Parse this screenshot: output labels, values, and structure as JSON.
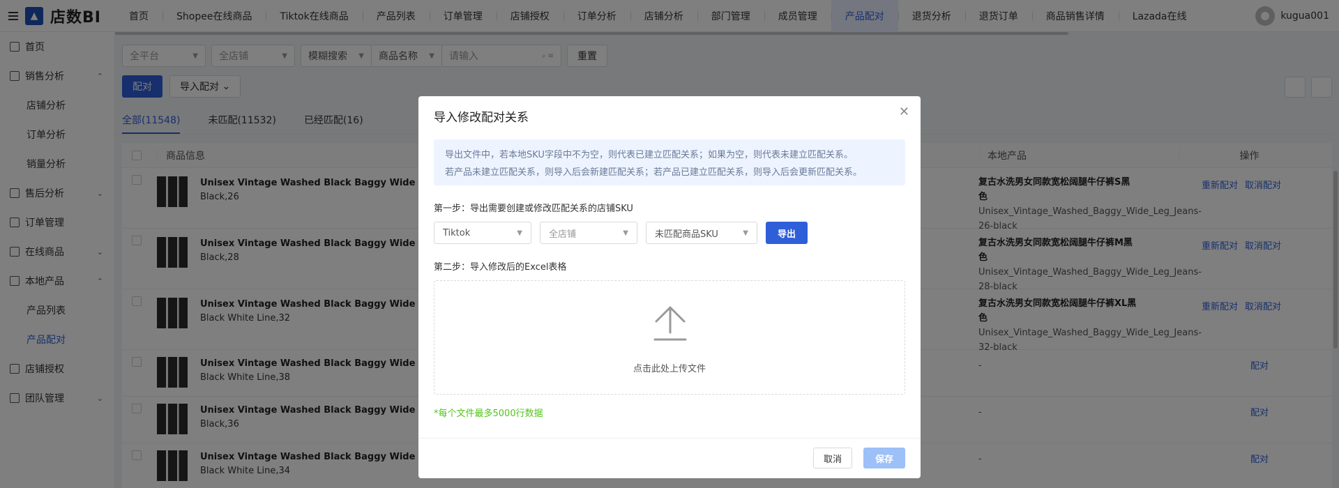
{
  "app": {
    "logo_text": "店数BI",
    "user": "kugua001"
  },
  "nav": {
    "tabs": [
      "首页",
      "Shopee在线商品",
      "Tiktok在线商品",
      "产品列表",
      "订单管理",
      "店铺授权",
      "订单分析",
      "店铺分析",
      "部门管理",
      "成员管理",
      "产品配对",
      "退货分析",
      "退货订单",
      "商品销售详情",
      "Lazada在线"
    ],
    "active": "产品配对"
  },
  "sidebar": {
    "items": [
      {
        "label": "首页",
        "icon": "home-icon"
      },
      {
        "label": "销售分析",
        "icon": "chart-icon",
        "chev": "⌃"
      },
      {
        "label": "店铺分析",
        "sub": true
      },
      {
        "label": "订单分析",
        "sub": true
      },
      {
        "label": "销量分析",
        "sub": true
      },
      {
        "label": "售后分析",
        "icon": "aftersale-icon",
        "chev": "⌄"
      },
      {
        "label": "订单管理",
        "icon": "order-icon"
      },
      {
        "label": "在线商品",
        "icon": "shop-icon",
        "chev": "⌄"
      },
      {
        "label": "本地产品",
        "icon": "box-icon",
        "chev": "⌃"
      },
      {
        "label": "产品列表",
        "sub": true
      },
      {
        "label": "产品配对",
        "sub": true,
        "active": true
      },
      {
        "label": "店铺授权",
        "icon": "shield-icon"
      },
      {
        "label": "团队管理",
        "icon": "team-icon",
        "chev": "⌄"
      }
    ]
  },
  "filters": {
    "platform": "全平台",
    "store": "全店铺",
    "search_mode": "模糊搜索",
    "field": "商品名称",
    "input_placeholder": "请输入",
    "reset": "重置"
  },
  "actions": {
    "pair": "配对",
    "import": "导入配对"
  },
  "tabs": [
    "全部(11548)",
    "未匹配(11532)",
    "已经匹配(16)"
  ],
  "table": {
    "headers": {
      "product": "商品信息",
      "local": "本地产品",
      "ops": "操作"
    },
    "rows": [
      {
        "name": "Unisex Vintage Washed Black Baggy Wide Leg J",
        "variant": "Black,26",
        "local_title": "复古水洗男女同款宽松阔腿牛仔裤S黑色",
        "local_sku": "Unisex_Vintage_Washed_Baggy_Wide_Leg_Jeans-26-black",
        "ops": [
          "重新配对",
          "取消配对"
        ]
      },
      {
        "name": "Unisex Vintage Washed Black Baggy Wide Leg J",
        "variant": "Black,28",
        "local_title": "复古水洗男女同款宽松阔腿牛仔裤M黑色",
        "local_sku": "Unisex_Vintage_Washed_Baggy_Wide_Leg_Jeans-28-black",
        "ops": [
          "重新配对",
          "取消配对"
        ]
      },
      {
        "name": "Unisex Vintage Washed Black Baggy Wide Leg J",
        "variant": "Black White Line,32",
        "local_title": "复古水洗男女同款宽松阔腿牛仔裤XL黑色",
        "local_sku": "Unisex_Vintage_Washed_Baggy_Wide_Leg_Jeans-32-black",
        "ops": [
          "重新配对",
          "取消配对"
        ]
      },
      {
        "name": "Unisex Vintage Washed Black Baggy Wide Leg J",
        "variant": "Black White Line,38",
        "local_title": "-",
        "local_sku": "",
        "ops": [
          "配对"
        ]
      },
      {
        "name": "Unisex Vintage Washed Black Baggy Wide Leg J",
        "variant": "Black,36",
        "local_title": "-",
        "local_sku": "",
        "ops": [
          "配对"
        ]
      },
      {
        "name": "Unisex Vintage Washed Black Baggy Wide Leg J",
        "variant": "Black White Line,34",
        "local_title": "-",
        "local_sku": "",
        "ops": [
          "配对"
        ]
      }
    ]
  },
  "modal": {
    "title": "导入修改配对关系",
    "note_line1": "导出文件中，若本地SKU字段中不为空，则代表已建立匹配关系；如果为空，则代表未建立匹配关系。",
    "note_line2": "若产品未建立匹配关系，则导入后会新建匹配关系；若产品已建立匹配关系，则导入后会更新匹配关系。",
    "step1": "第一步：导出需要创建或修改匹配关系的店铺SKU",
    "platform": "Tiktok",
    "store": "全店铺",
    "sku_filter": "未匹配商品SKU",
    "export": "导出",
    "step2": "第二步：导入修改后的Excel表格",
    "upload_text": "点击此处上传文件",
    "limit": "*每个文件最多5000行数据",
    "cancel": "取消",
    "save": "保存"
  }
}
